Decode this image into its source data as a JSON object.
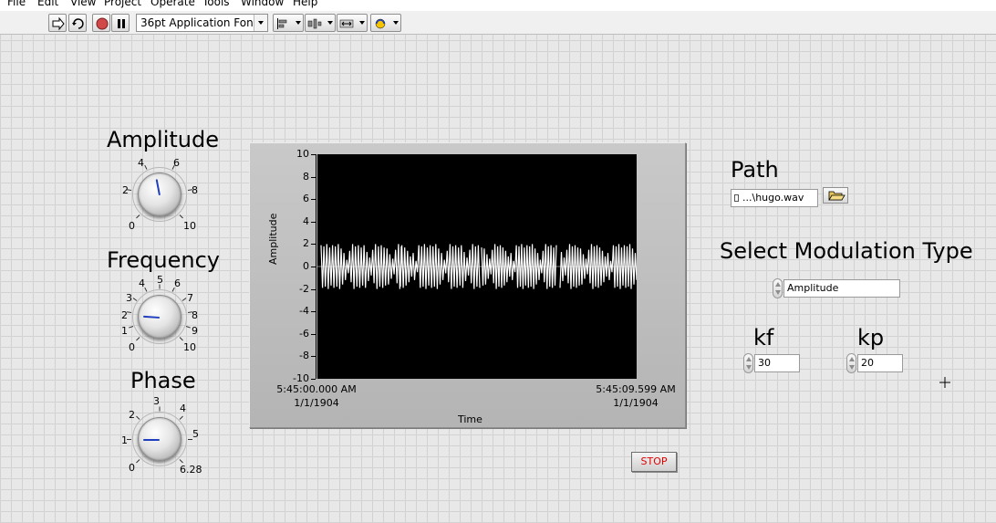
{
  "menu": [
    "File",
    "Edit",
    "View",
    "Project",
    "Operate",
    "Tools",
    "Window",
    "Help"
  ],
  "toolbar": {
    "font_select": "36pt Application Font",
    "icons": [
      "run-arrow-icon",
      "run-continuously-icon",
      "abort-icon",
      "pause-icon",
      "align-objects-icon",
      "distribute-objects-icon",
      "resize-objects-icon",
      "reorder-icon"
    ]
  },
  "colors": {
    "needle": "#1f3fbf",
    "stop_text": "#e00000",
    "plot_bg": "#000000",
    "trace": "#ffffff"
  },
  "knobs": {
    "amplitude": {
      "label": "Amplitude",
      "ticks": [
        "0",
        "2",
        "4",
        "6",
        "8",
        "10"
      ],
      "value": 4.6,
      "max": 10
    },
    "frequency": {
      "label": "Frequency",
      "ticks": [
        "0",
        "1",
        "2",
        "3",
        "4",
        "5",
        "6",
        "7",
        "8",
        "9",
        "10"
      ],
      "value": 1.8,
      "max": 10
    },
    "phase": {
      "label": "Phase",
      "ticks": [
        "0",
        "1",
        "2",
        "3",
        "4",
        "5",
        "6.28"
      ],
      "value": 1.05,
      "max": 6.28
    }
  },
  "graph": {
    "y_title": "Amplitude",
    "x_title": "Time",
    "y_ticks": [
      "10",
      "8",
      "6",
      "4",
      "2",
      "0",
      "-2",
      "-4",
      "-6",
      "-8",
      "-10"
    ],
    "x_start": {
      "time": "5:45:00.000 AM",
      "date": "1/1/1904"
    },
    "x_end": {
      "time": "5:45:09.599 AM",
      "date": "1/1/1904"
    }
  },
  "chart_data": {
    "type": "line",
    "title": "",
    "xlabel": "Time",
    "ylabel": "Amplitude",
    "ylim": [
      -10,
      10
    ],
    "x_range": [
      "5:45:00.000 AM",
      "5:45:09.599 AM"
    ],
    "series": [
      {
        "values": [
          1.9,
          -1.9,
          1.8,
          -1.8,
          2.0,
          -2.0,
          1.7,
          -1.7,
          1.9,
          -1.9,
          1.8,
          -1.8,
          2.0,
          -2.0,
          1.6,
          -1.6,
          1.2,
          -1.2,
          0.6,
          -0.6,
          1.4,
          -1.4,
          2.0,
          -2.0,
          1.8,
          -1.8,
          1.9,
          -1.9,
          1.7,
          -1.7,
          1.9,
          -1.9,
          1.3,
          -1.3,
          0.8,
          -0.8,
          1.5,
          -1.5,
          2.0,
          -2.0,
          1.8,
          -1.8,
          1.9,
          -1.9,
          1.7,
          -1.7,
          1.6,
          -1.6,
          1.1,
          -1.1,
          0.7,
          -0.7,
          1.5,
          -1.5,
          2.0,
          -2.0,
          1.8,
          -1.8,
          1.9,
          -1.9,
          1.7,
          -1.7,
          1.4,
          -1.4,
          0.9,
          -0.9,
          1.2,
          -1.2,
          0.5,
          -0.5
        ]
      }
    ]
  },
  "path": {
    "label": "Path",
    "value": "...\\hugo.wav"
  },
  "modulation": {
    "label": "Select Modulation Type",
    "value": "Amplitude"
  },
  "kf": {
    "label": "kf",
    "value": "30"
  },
  "kp": {
    "label": "kp",
    "value": "20"
  },
  "stop": {
    "label": "STOP"
  }
}
